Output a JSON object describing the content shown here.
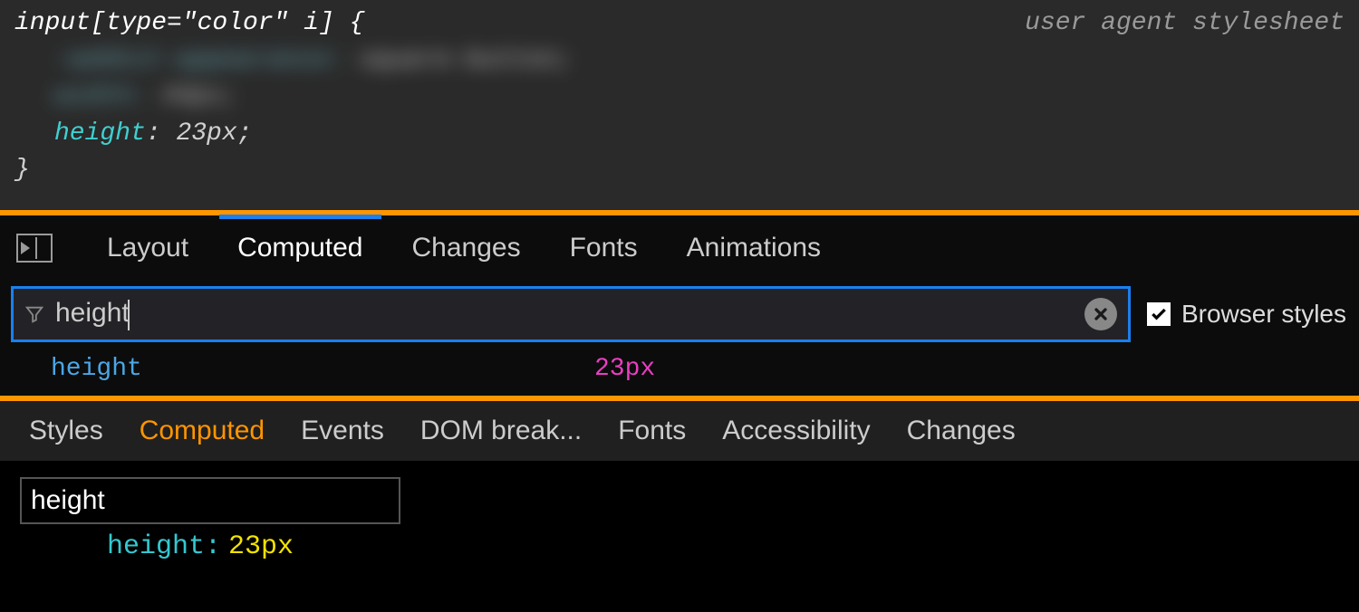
{
  "rule": {
    "selector": "input[type=\"color\" i] {",
    "ua_label": "user agent stylesheet",
    "blur1_prop": "-webkit-appearance:",
    "blur1_val": "square-button;",
    "blur2_prop": "width:",
    "blur2_val": "44px;",
    "prop": "height",
    "colon": ":",
    "val": " 23px;",
    "close_brace": "}"
  },
  "ff_tabs": {
    "layout": "Layout",
    "computed": "Computed",
    "changes": "Changes",
    "fonts": "Fonts",
    "animations": "Animations"
  },
  "ff_filter": {
    "value": "height",
    "browser_styles_label": "Browser styles"
  },
  "ff_result": {
    "name": "height",
    "value": "23px"
  },
  "cr_tabs": {
    "styles": "Styles",
    "computed": "Computed",
    "events": "Events",
    "dom": "DOM break...",
    "fonts": "Fonts",
    "accessibility": "Accessibility",
    "changes": "Changes"
  },
  "cr_filter": {
    "value": "height"
  },
  "cr_result": {
    "name": "height",
    "colon": ":",
    "value": "23px"
  }
}
